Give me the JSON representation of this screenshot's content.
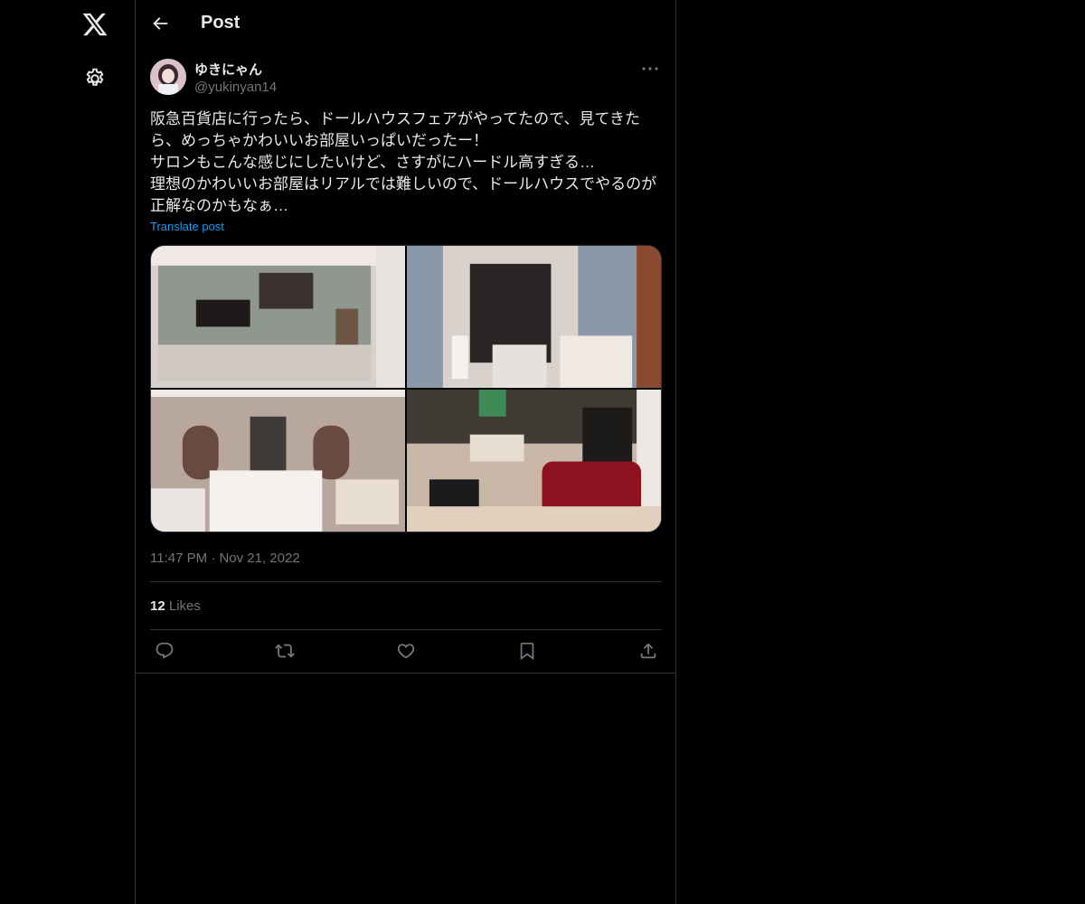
{
  "nav": {
    "logo_icon": "x-logo-icon",
    "settings_icon": "gear-icon"
  },
  "header": {
    "title": "Post",
    "back_icon": "arrow-left-icon"
  },
  "post": {
    "author_name": "ゆきにゃん",
    "author_handle": "@yukinyan14",
    "text": "阪急百貨店に行ったら、ドールハウスフェアがやってたので、見てきたら、めっちゃかわいいお部屋いっぱいだったー！\nサロンもこんな感じにしたいけど、さすがにハードル高すぎる…\n理想のかわいいお部屋はリアルでは難しいので、ドールハウスでやるのが正解なのかもなぁ…",
    "translate_label": "Translate post",
    "time": "11:47 PM",
    "separator": "·",
    "date": "Nov 21, 2022",
    "likes_count": "12",
    "likes_label": "Likes",
    "accent_color": "#1d9bf0",
    "background_color": "#000000"
  },
  "actions": {
    "reply_icon": "reply-icon",
    "repost_icon": "repost-icon",
    "like_icon": "heart-icon",
    "bookmark_icon": "bookmark-icon",
    "share_icon": "share-icon"
  }
}
